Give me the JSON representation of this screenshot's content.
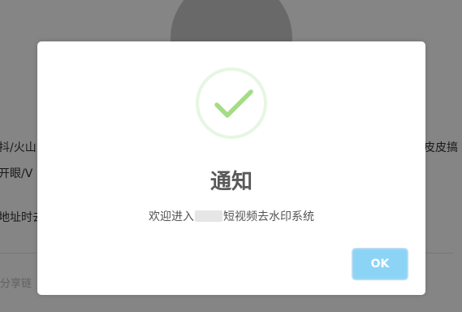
{
  "background": {
    "left_lines": [
      "抖/火山",
      "开眼/V",
      "地址时去"
    ],
    "right_line": "皮皮搞",
    "share_placeholder": "分享链"
  },
  "modal": {
    "title": "通知",
    "message_before": "欢迎进入",
    "message_after": "短视频去水印系统",
    "ok_label": "OK"
  },
  "colors": {
    "success": "#a5dc86",
    "ok_button": "#8cd4f5",
    "overlay": "rgba(0,0,0,0.48)"
  }
}
